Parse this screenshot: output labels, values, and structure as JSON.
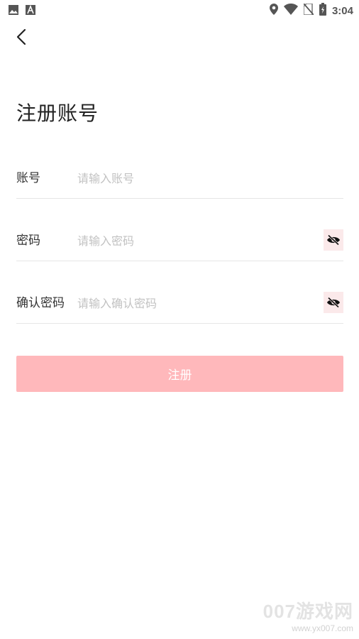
{
  "status_bar": {
    "time": "3:04"
  },
  "page": {
    "title": "注册账号"
  },
  "form": {
    "account": {
      "label": "账号",
      "placeholder": "请输入账号"
    },
    "password": {
      "label": "密码",
      "placeholder": "请输入密码"
    },
    "confirm_password": {
      "label": "确认密码",
      "placeholder": "请输入确认密码"
    },
    "submit_label": "注册"
  },
  "watermark": {
    "brand": "007游戏网",
    "url": "www.yx007.com"
  },
  "colors": {
    "accent": "#ffb8bb",
    "eye_bg": "#fbe9ea",
    "divider": "#e6e6e6",
    "placeholder": "#c2c2c2"
  },
  "icons": [
    "image-icon",
    "font-icon",
    "location-icon",
    "wifi-icon",
    "no-sim-icon",
    "battery-icon",
    "back-arrow-icon",
    "eye-off-icon"
  ]
}
